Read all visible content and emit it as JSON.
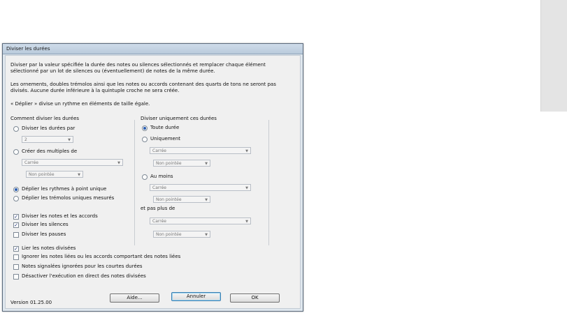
{
  "dialog": {
    "title": "Diviser les durées",
    "description1": "Diviser par la valeur spécifiée la durée des notes ou silences sélectionnés et remplacer chaque élément sélectionné par un lot de silences ou (éventuellement) de notes de la même durée.",
    "description2": "Les ornements, doubles trémolos ainsi que les notes ou accords contenant des quarts de tons ne seront pas divisés. Aucune durée inférieure à la quintuple croche ne sera créée.",
    "description3": "« Déplier » divise un rythme en éléments de taille égale.",
    "left": {
      "heading": "Comment diviser les durées",
      "radio_divide_by": "Diviser les durées par",
      "divide_value": "2",
      "radio_multiples": "Créer des multiples de",
      "multiples_note": "Carrée",
      "multiples_dot": "Non pointée",
      "radio_unfold_single": "Déplier les rythmes à point unique",
      "radio_unfold_tremolo": "Déplier les trémolos uniques mesurés",
      "check_notes_chords": "Diviser les notes et les accords",
      "check_rests": "Diviser les silences",
      "check_pauses": "Diviser les pauses",
      "selected_radio": "radio_unfold_single"
    },
    "right": {
      "heading": "Diviser uniquement ces durées",
      "radio_all": "Toute durée",
      "radio_only": "Uniquement",
      "only_note": "Carrée",
      "only_dot": "Non pointée",
      "radio_at_least": "Au moins",
      "at_least_note": "Carrée",
      "at_least_dot": "Non pointée",
      "not_more_label": "et pas plus de",
      "not_more_note": "Carrée",
      "not_more_dot": "Non pointée",
      "selected_radio": "radio_all"
    },
    "bottom": {
      "check_tie": "Lier les notes divisées",
      "check_ignore_tied": "Ignorer les notes liées ou les accords comportant des notes liées",
      "check_ignored_short": "Notes signalées ignorées pour les courtes durées",
      "check_disable_playback": "Désactiver l'exécution en direct des notes divisées"
    },
    "version": "Version 01.25.00",
    "buttons": {
      "help": "Aide...",
      "cancel": "Annuler",
      "ok": "OK"
    }
  }
}
